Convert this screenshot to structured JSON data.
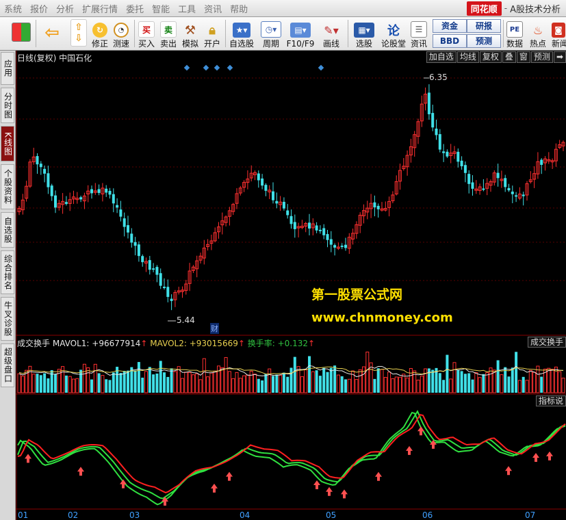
{
  "menubar": {
    "items": [
      "系统",
      "报价",
      "分析",
      "扩展行情",
      "委托",
      "智能",
      "工具",
      "资讯",
      "帮助"
    ],
    "brand_logo": "同花顺",
    "brand_sep": "-",
    "brand_title": "A股技术分析"
  },
  "toolbar": {
    "buttons": [
      {
        "label": "",
        "icon": "window-layout-icon"
      },
      {
        "label": "",
        "icon": "back-arrow-icon"
      },
      {
        "label": "",
        "icon": "up-down-arrows-icon"
      },
      {
        "label": "修正",
        "icon": "refresh-icon"
      },
      {
        "label": "测速",
        "icon": "clock-icon"
      },
      {
        "label": "买入",
        "icon": "buy-icon",
        "glyph": "买"
      },
      {
        "label": "卖出",
        "icon": "sell-icon",
        "glyph": "卖"
      },
      {
        "label": "模拟",
        "icon": "hammer-icon"
      },
      {
        "label": "开户",
        "icon": "lock-icon"
      },
      {
        "label": "自选股",
        "icon": "star-card-icon"
      },
      {
        "label": "周期",
        "icon": "period-clock-icon"
      },
      {
        "label": "F10/F9",
        "icon": "f10-icon"
      },
      {
        "label": "画线",
        "icon": "pencil-icon"
      },
      {
        "label": "选股",
        "icon": "select-stock-icon"
      },
      {
        "label": "论股堂",
        "icon": "forum-icon",
        "glyph": "论"
      },
      {
        "label": "资讯",
        "icon": "news-icon"
      },
      {
        "label": "数据",
        "icon": "pe-icon",
        "glyph": "PE"
      },
      {
        "label": "热点",
        "icon": "hot-icon"
      },
      {
        "label": "新闻",
        "icon": "news-bag-icon"
      }
    ],
    "small_buttons": [
      "资金",
      "研报",
      "BBD",
      "预测"
    ]
  },
  "sidebar": {
    "tabs": [
      "应用",
      "分时图",
      "K线图",
      "个股资料",
      "自选股",
      "综合排名",
      "牛叉诊股",
      "超级盘口"
    ],
    "active_index": 2
  },
  "kline": {
    "title": "日线(复权)  中国石化",
    "buttons": [
      "加自选",
      "均线",
      "复权",
      "叠",
      "窗",
      "预测",
      "➡"
    ],
    "high_label": "6.35",
    "low_label": "5.44",
    "cai_label": "财"
  },
  "volume": {
    "name": "成交换手",
    "mavol1_label": "MAVOL1: +96677914",
    "mavol2_label": "MAVOL2: +93015669",
    "turnover_label": "换手率: +0.132",
    "up_arrow": "↑",
    "button": "成交换手"
  },
  "indicator": {
    "button": "指标说"
  },
  "watermark": {
    "line1": "第一股票公式网",
    "line2": "www.chnmoney.com"
  },
  "months": [
    "01",
    "02",
    "03",
    "04",
    "05",
    "06",
    "07"
  ],
  "colors": {
    "up": "#ff3030",
    "down": "#40e0e8",
    "green_line": "#30e040",
    "red_line": "#ff2020",
    "watermark": "#ffe000"
  }
}
